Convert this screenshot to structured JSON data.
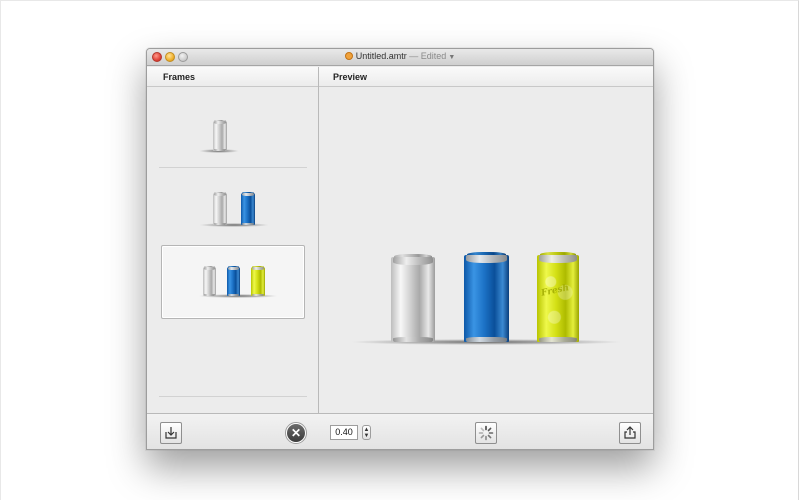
{
  "window": {
    "title": "Untitled.amtr",
    "status": "Edited",
    "doc_icon": "document-icon",
    "dropdown_icon": "chevron-down-icon"
  },
  "columns": {
    "frames_header": "Frames",
    "preview_header": "Preview"
  },
  "frames": [
    {
      "cans": [
        "silver"
      ],
      "selected": false
    },
    {
      "cans": [
        "silver",
        "blue"
      ],
      "selected": false
    },
    {
      "cans": [
        "silver",
        "blue",
        "yellow"
      ],
      "selected": true
    }
  ],
  "preview": {
    "cans": [
      "silver",
      "blue",
      "yellow"
    ],
    "label_text": "Fresh"
  },
  "toolbar": {
    "import_icon": "import-icon",
    "delete_icon": "delete-circle-icon",
    "delay_value": "0.40",
    "stepper_icon": "stepper-icon",
    "spinner_icon": "spinner-icon",
    "share_icon": "share-icon"
  },
  "colors": {
    "silver": "#d4d4d4",
    "blue": "#1c72c6",
    "yellow": "#d4e016",
    "window_bg": "#ececec"
  }
}
